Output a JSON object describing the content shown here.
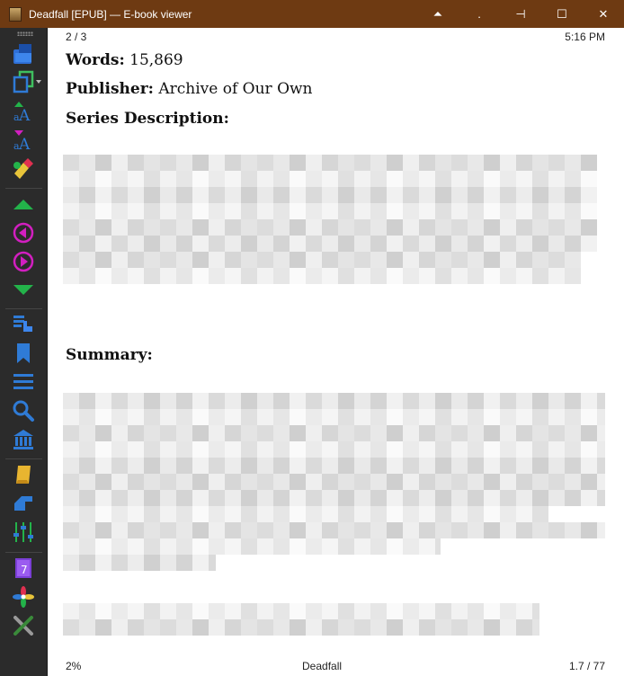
{
  "window": {
    "title": "Deadfall [EPUB] — E-book viewer",
    "controls": {
      "top": "⏶",
      "dot": ".",
      "pin": "⊣",
      "maximize": "☐",
      "close": "✕"
    }
  },
  "toolbar": {
    "buttons": [
      {
        "name": "open-book-icon"
      },
      {
        "name": "copy-icon"
      },
      {
        "name": "font-larger-icon"
      },
      {
        "name": "font-smaller-icon"
      },
      {
        "name": "color-scheme-icon"
      },
      {
        "name": "previous-section-icon"
      },
      {
        "name": "back-icon"
      },
      {
        "name": "forward-icon"
      },
      {
        "name": "next-section-icon"
      },
      {
        "name": "goto-location-icon"
      },
      {
        "name": "bookmark-icon"
      },
      {
        "name": "table-of-contents-icon"
      },
      {
        "name": "search-icon"
      },
      {
        "name": "reference-mode-icon"
      },
      {
        "name": "highlights-icon"
      },
      {
        "name": "toggle-toolbar-icon"
      },
      {
        "name": "preferences-icon"
      },
      {
        "name": "metadata-icon"
      },
      {
        "name": "inspector-icon"
      },
      {
        "name": "quit-icon"
      }
    ],
    "colors": {
      "background": "#2b2b2b",
      "accent_blue": "#2f7bd6",
      "accent_green": "#23b34a",
      "accent_magenta": "#d21fc0"
    }
  },
  "page": {
    "header_left": "2 / 3",
    "header_right": "5:16 PM",
    "words_label": "Words:",
    "words_value": "15,869",
    "publisher_label": "Publisher:",
    "publisher_value": "Archive of Our Own",
    "series_description_label": "Series Description:",
    "summary_label": "Summary:",
    "footer_left": "2%",
    "footer_center": "Deadfall",
    "footer_right": "1.7 / 77"
  }
}
